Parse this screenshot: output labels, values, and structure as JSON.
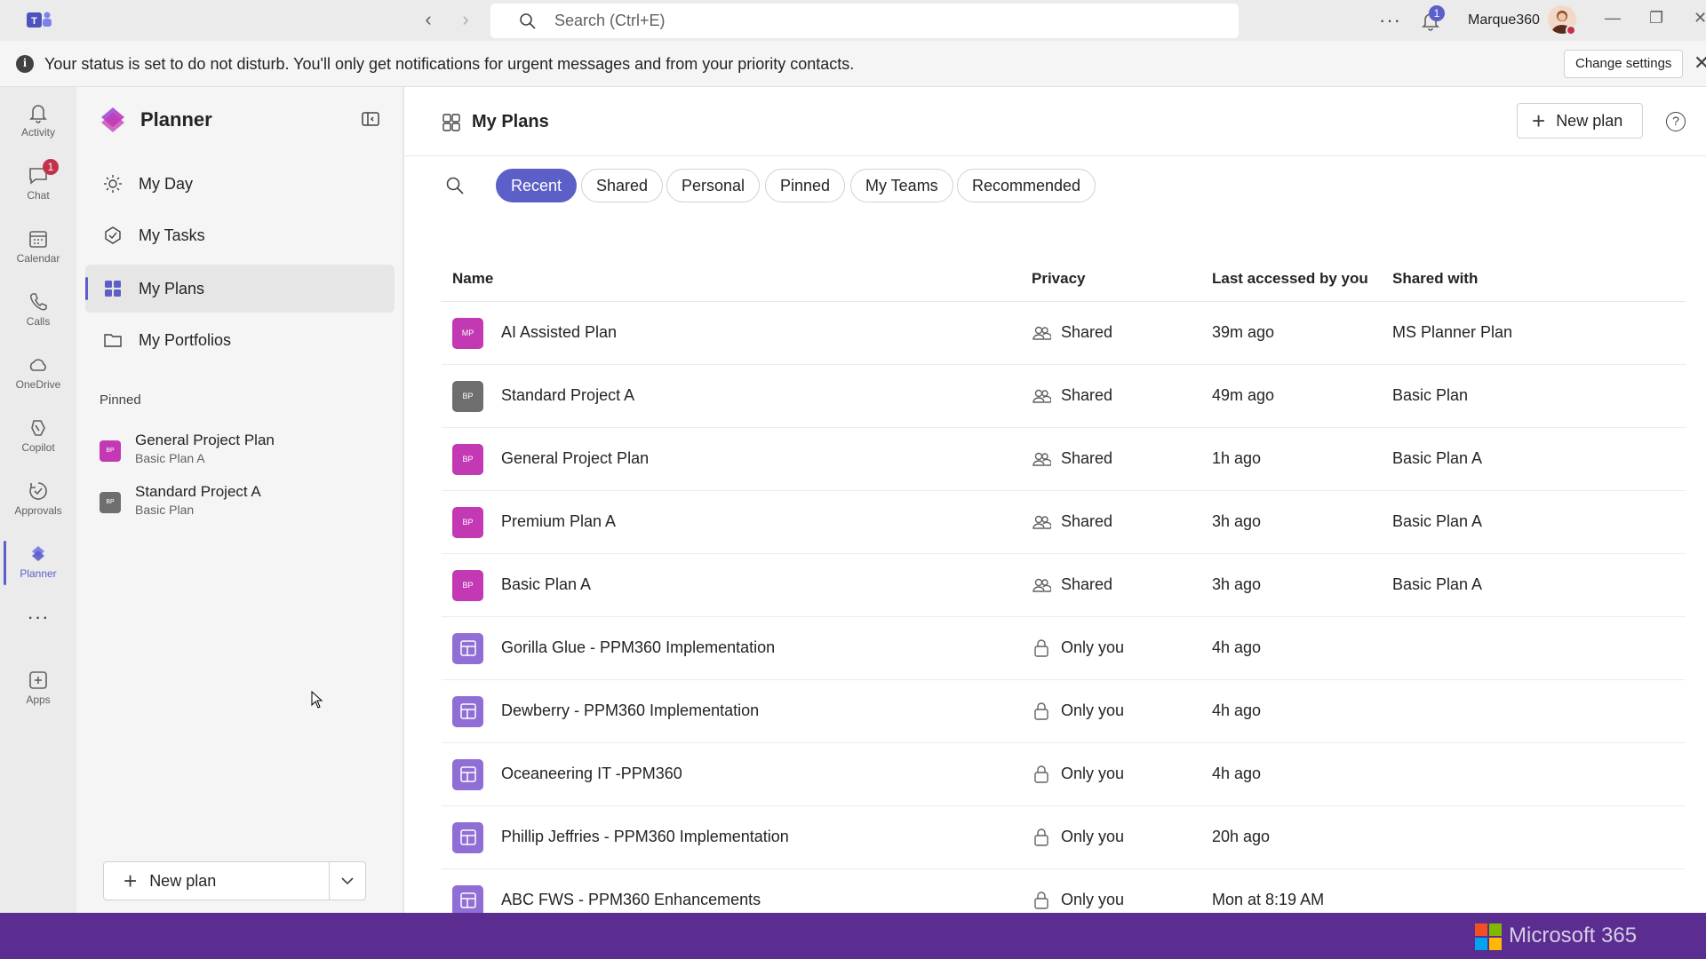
{
  "titlebar": {
    "search_placeholder": "Search (Ctrl+E)",
    "notification_count": "1",
    "user_name": "Marque360"
  },
  "notice": {
    "text": "Your status is set to do not disturb. You'll only get notifications for urgent messages and from your priority contacts.",
    "button": "Change settings"
  },
  "rail": {
    "items": [
      {
        "label": "Activity",
        "icon": "bell-icon"
      },
      {
        "label": "Chat",
        "icon": "chat-icon",
        "badge": "1"
      },
      {
        "label": "Calendar",
        "icon": "calendar-icon"
      },
      {
        "label": "Calls",
        "icon": "phone-icon"
      },
      {
        "label": "OneDrive",
        "icon": "cloud-icon"
      },
      {
        "label": "Copilot",
        "icon": "copilot-icon"
      },
      {
        "label": "Approvals",
        "icon": "approvals-icon"
      },
      {
        "label": "Planner",
        "icon": "planner-icon",
        "active": true
      },
      {
        "label": "Apps",
        "icon": "apps-icon"
      }
    ]
  },
  "planner": {
    "title": "Planner",
    "nav": [
      {
        "label": "My Day",
        "icon": "sun-icon"
      },
      {
        "label": "My Tasks",
        "icon": "tasks-icon"
      },
      {
        "label": "My Plans",
        "icon": "grid-icon",
        "selected": true
      },
      {
        "label": "My Portfolios",
        "icon": "folder-icon"
      }
    ],
    "pinned_label": "Pinned",
    "pinned": [
      {
        "name": "General Project Plan",
        "sub": "Basic Plan A",
        "badge": "BP",
        "color": "#c239b3"
      },
      {
        "name": "Standard Project A",
        "sub": "Basic Plan",
        "badge": "BP",
        "color": "#6e6e6e"
      }
    ],
    "new_plan": "New plan"
  },
  "main": {
    "title": "My Plans",
    "new_plan": "New plan",
    "filters": [
      "Recent",
      "Shared",
      "Personal",
      "Pinned",
      "My Teams",
      "Recommended"
    ],
    "active_filter": "Recent",
    "columns": {
      "name": "Name",
      "privacy": "Privacy",
      "last": "Last accessed by you",
      "shared": "Shared with"
    },
    "rows": [
      {
        "badge": "MP",
        "color": "#c239b3",
        "name": "AI Assisted Plan",
        "privacy": "Shared",
        "last": "39m ago",
        "shared": "MS Planner Plan"
      },
      {
        "badge": "BP",
        "color": "#6e6e6e",
        "name": "Standard Project A",
        "privacy": "Shared",
        "last": "49m ago",
        "shared": "Basic Plan"
      },
      {
        "badge": "BP",
        "color": "#c239b3",
        "name": "General Project Plan",
        "privacy": "Shared",
        "last": "1h ago",
        "shared": "Basic Plan A"
      },
      {
        "badge": "BP",
        "color": "#c239b3",
        "name": "Premium Plan A",
        "privacy": "Shared",
        "last": "3h ago",
        "shared": "Basic Plan A"
      },
      {
        "badge": "BP",
        "color": "#c239b3",
        "name": "Basic Plan A",
        "privacy": "Shared",
        "last": "3h ago",
        "shared": "Basic Plan A"
      },
      {
        "badge": "",
        "color": "#8f6ed5",
        "name": "Gorilla Glue - PPM360 Implementation",
        "privacy": "Only you",
        "last": "4h ago",
        "shared": ""
      },
      {
        "badge": "",
        "color": "#8f6ed5",
        "name": "Dewberry - PPM360 Implementation",
        "privacy": "Only you",
        "last": "4h ago",
        "shared": ""
      },
      {
        "badge": "",
        "color": "#8f6ed5",
        "name": "Oceaneering IT -PPM360",
        "privacy": "Only you",
        "last": "4h ago",
        "shared": ""
      },
      {
        "badge": "",
        "color": "#8f6ed5",
        "name": "Phillip Jeffries - PPM360 Implementation",
        "privacy": "Only you",
        "last": "20h ago",
        "shared": ""
      },
      {
        "badge": "",
        "color": "#8f6ed5",
        "name": "ABC FWS - PPM360 Enhancements",
        "privacy": "Only you",
        "last": "Mon at 8:19 AM",
        "shared": ""
      }
    ]
  },
  "footer": {
    "brand": "Microsoft 365"
  },
  "colors": {
    "accent": "#5b5fc7",
    "brand_bar": "#5c2d91"
  }
}
